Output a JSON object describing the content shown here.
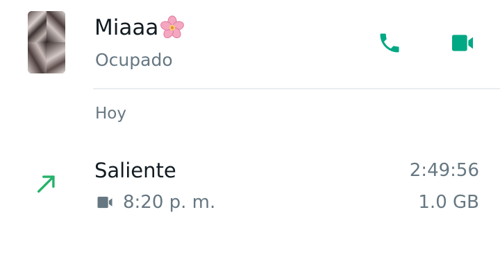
{
  "contact": {
    "name": "Miaaa",
    "name_emoji": "cherry-blossom-icon",
    "status": "Ocupado"
  },
  "actions": {
    "call_icon": "phone-icon",
    "video_icon": "video-camera-icon"
  },
  "section": {
    "label": "Hoy"
  },
  "call": {
    "direction_icon": "outgoing-arrow-icon",
    "type": "Saliente",
    "media_icon": "video-camera-icon",
    "time": "8:20 p. m.",
    "duration": "2:49:56",
    "data_used": "1.0 GB"
  },
  "colors": {
    "accent": "#00a884",
    "outgoing_arrow": "#25b26a",
    "primary_text": "#111b21",
    "secondary_text": "#667781",
    "divider": "#e9edef"
  }
}
